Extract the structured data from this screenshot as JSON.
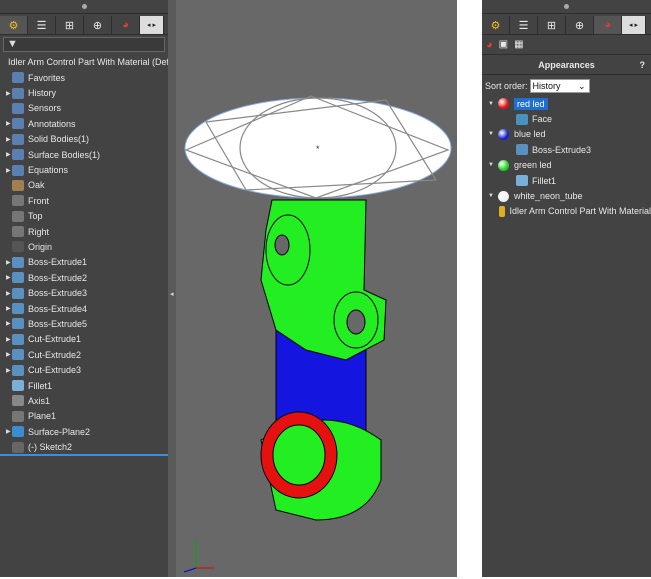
{
  "left": {
    "root": "Idler Arm Control Part With Material (Default)",
    "filter_icon": "funnel-icon",
    "items": [
      {
        "label": "Favorites",
        "icon": "folder-star",
        "arrow": false
      },
      {
        "label": "History",
        "icon": "folder-history",
        "arrow": true
      },
      {
        "label": "Sensors",
        "icon": "folder-sensor",
        "arrow": false
      },
      {
        "label": "Annotations",
        "icon": "folder-annotation",
        "arrow": true
      },
      {
        "label": "Solid Bodies(1)",
        "icon": "folder-solid",
        "arrow": true
      },
      {
        "label": "Surface Bodies(1)",
        "icon": "folder-surface",
        "arrow": true
      },
      {
        "label": "Equations",
        "icon": "folder-equation",
        "arrow": true
      },
      {
        "label": "Oak",
        "icon": "material",
        "arrow": false
      },
      {
        "label": "Front",
        "icon": "plane",
        "arrow": false
      },
      {
        "label": "Top",
        "icon": "plane",
        "arrow": false
      },
      {
        "label": "Right",
        "icon": "plane",
        "arrow": false
      },
      {
        "label": "Origin",
        "icon": "origin",
        "arrow": false
      },
      {
        "label": "Boss-Extrude1",
        "icon": "extrude",
        "arrow": true
      },
      {
        "label": "Boss-Extrude2",
        "icon": "extrude",
        "arrow": true
      },
      {
        "label": "Boss-Extrude3",
        "icon": "extrude",
        "arrow": true
      },
      {
        "label": "Boss-Extrude4",
        "icon": "extrude",
        "arrow": true
      },
      {
        "label": "Boss-Extrude5",
        "icon": "extrude",
        "arrow": true
      },
      {
        "label": "Cut-Extrude1",
        "icon": "cut",
        "arrow": true
      },
      {
        "label": "Cut-Extrude2",
        "icon": "cut",
        "arrow": true
      },
      {
        "label": "Cut-Extrude3",
        "icon": "cut",
        "arrow": true
      },
      {
        "label": "Fillet1",
        "icon": "fillet",
        "arrow": false
      },
      {
        "label": "Axis1",
        "icon": "axis",
        "arrow": false
      },
      {
        "label": "Plane1",
        "icon": "plane",
        "arrow": false
      },
      {
        "label": "Surface-Plane2",
        "icon": "surface",
        "arrow": true
      },
      {
        "label": "(-) Sketch2",
        "icon": "sketch",
        "arrow": false
      }
    ]
  },
  "right": {
    "title": "Appearances",
    "sort_label": "Sort order:",
    "sort_value": "History",
    "items": [
      {
        "label": "red led",
        "color": "#e01010",
        "level": 0,
        "selected": true
      },
      {
        "label": "Face",
        "level": 1,
        "icon": "face"
      },
      {
        "label": "blue led",
        "color": "#1020d0",
        "level": 0
      },
      {
        "label": "Boss-Extrude3",
        "level": 1,
        "icon": "extrude"
      },
      {
        "label": "green led",
        "color": "#20d020",
        "level": 0
      },
      {
        "label": "Fillet1",
        "level": 1,
        "icon": "fillet"
      },
      {
        "label": "white_neon_tube",
        "color": "#f0f0f0",
        "level": 0
      },
      {
        "label": "Idler Arm Control Part With Material",
        "level": 1,
        "icon": "part"
      }
    ]
  },
  "colors": {
    "panel": "#434343",
    "viewport": "#686868",
    "selection": "#1f6fd0"
  }
}
